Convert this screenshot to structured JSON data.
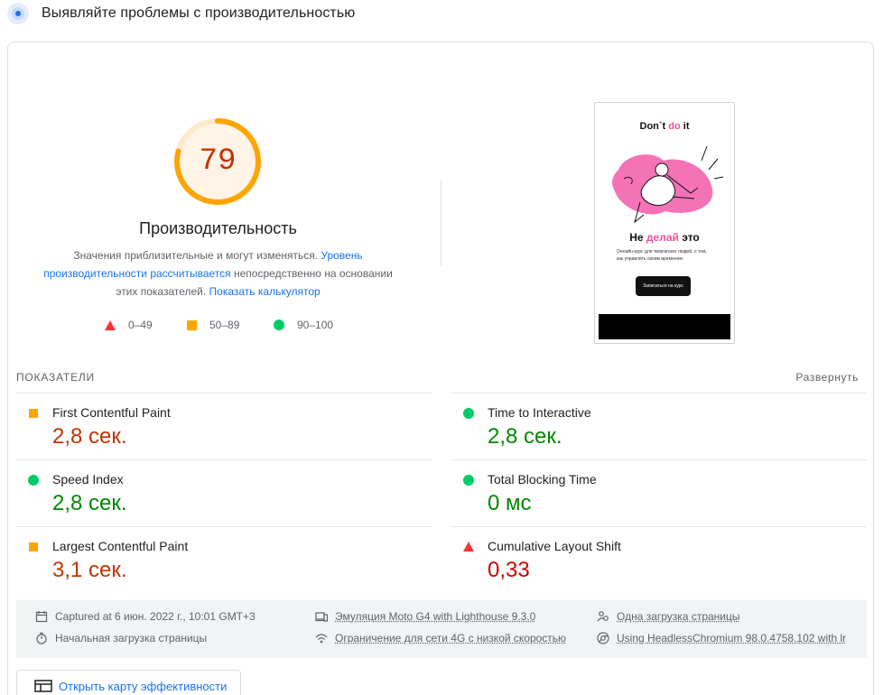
{
  "header": {
    "title": "Выявляйте проблемы с производительностью"
  },
  "score": {
    "value": "79",
    "fraction": 0.79,
    "color": "#ffa400"
  },
  "performance": {
    "title": "Производительность",
    "desc_1": "Значения приблизительные и могут изменяться. ",
    "desc_link_1": "Уровень производительности рассчитывается",
    "desc_2": " непосредственно на основании этих показателей. ",
    "desc_link_2": "Показать калькулятор"
  },
  "legend": [
    {
      "range": "0–49",
      "icon": "triangle-icon"
    },
    {
      "range": "50–89",
      "icon": "square-icon"
    },
    {
      "range": "90–100",
      "icon": "circle-icon"
    }
  ],
  "screenshot": {
    "title_a": "Don`t ",
    "title_b": "do",
    "title_c": " it",
    "sub_a": "Не ",
    "sub_b": "делай",
    "sub_c": " это",
    "text": "Онлайн-курс для творческих людей, о том, как управлять своим временем",
    "button": "Записаться на курс"
  },
  "metrics_section": {
    "label": "ПОКАЗАТЕЛИ",
    "expand": "Развернуть"
  },
  "metrics": [
    {
      "name": "First Contentful Paint",
      "value": "2,8 сек.",
      "status": "average"
    },
    {
      "name": "Time to Interactive",
      "value": "2,8 сек.",
      "status": "pass"
    },
    {
      "name": "Speed Index",
      "value": "2,8 сек.",
      "status": "pass"
    },
    {
      "name": "Total Blocking Time",
      "value": "0 мс",
      "status": "pass"
    },
    {
      "name": "Largest Contentful Paint",
      "value": "3,1 сек.",
      "status": "average"
    },
    {
      "name": "Cumulative Layout Shift",
      "value": "0,33",
      "status": "fail"
    }
  ],
  "meta": {
    "captured": "Captured at 6 июн. 2022 г., 10:01 GMT+3",
    "initial_load": "Начальная загрузка страницы",
    "emulation": "Эмуляция Moto G4 with Lighthouse 9.3.0",
    "throttling": "Ограничение для сети 4G с низкой скоростью",
    "single_load": "Одна загрузка страницы",
    "browser": "Using HeadlessChromium 98.0.4758.102 with lr"
  },
  "treemap": {
    "label": "Открыть карту эффективности"
  }
}
